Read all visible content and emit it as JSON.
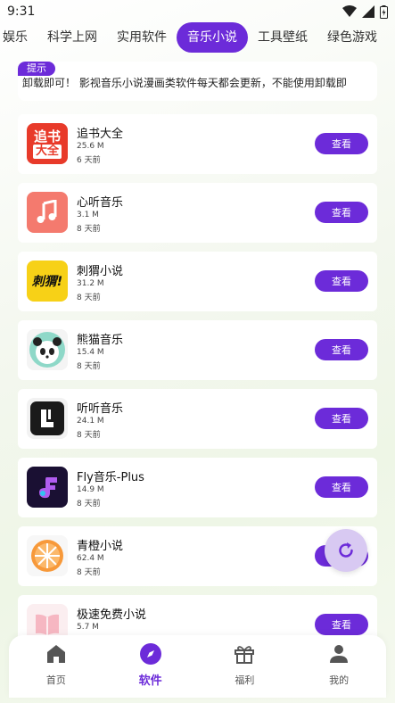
{
  "status_bar": {
    "time": "9:31"
  },
  "tabs": [
    {
      "label": "娱乐",
      "active": false
    },
    {
      "label": "科学上网",
      "active": false
    },
    {
      "label": "实用软件",
      "active": false
    },
    {
      "label": "音乐小说",
      "active": true
    },
    {
      "label": "工具壁纸",
      "active": false
    },
    {
      "label": "绿色游戏",
      "active": false
    }
  ],
  "notice": {
    "badge": "提示",
    "text": "卸载即可！   影视音乐小说漫画类软件每天都会更新，不能使用卸载即"
  },
  "apps": [
    {
      "name": "追书大全",
      "size": "25.6 M",
      "time": "6 天前",
      "button": "查看",
      "icon": "zhuishu-icon"
    },
    {
      "name": "心听音乐",
      "size": "3.1 M",
      "time": "8 天前",
      "button": "查看",
      "icon": "music-note-icon"
    },
    {
      "name": "刺猬小说",
      "size": "31.2 M",
      "time": "8 天前",
      "button": "查看",
      "icon": "ciwei-icon"
    },
    {
      "name": "熊猫音乐",
      "size": "15.4 M",
      "time": "8 天前",
      "button": "查看",
      "icon": "panda-icon"
    },
    {
      "name": "听听音乐",
      "size": "24.1 M",
      "time": "8 天前",
      "button": "查看",
      "icon": "tingting-icon"
    },
    {
      "name": "Fly音乐-Plus",
      "size": "14.9 M",
      "time": "8 天前",
      "button": "查看",
      "icon": "fly-icon"
    },
    {
      "name": "青橙小说",
      "size": "62.4 M",
      "time": "8 天前",
      "button": "查看",
      "icon": "orange-icon"
    },
    {
      "name": "极速免费小说",
      "size": "5.7 M",
      "time": "",
      "button": "查看",
      "icon": "book-icon"
    }
  ],
  "icon_texts": {
    "zhuishu_top": "追书",
    "zhuishu_bottom": "大全",
    "ciwei": "刺猬!"
  },
  "bottom_nav": [
    {
      "label": "首页",
      "icon": "home-icon",
      "active": false
    },
    {
      "label": "软件",
      "icon": "compass-icon",
      "active": true
    },
    {
      "label": "福利",
      "icon": "gift-icon",
      "active": false
    },
    {
      "label": "我的",
      "icon": "user-icon",
      "active": false
    }
  ],
  "colors": {
    "accent": "#6c2bd9",
    "fab": "#d8c9f2"
  }
}
